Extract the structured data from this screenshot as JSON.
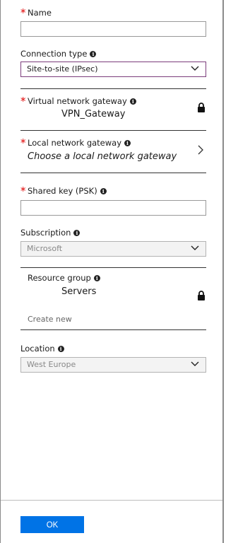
{
  "form": {
    "name": {
      "label": "Name",
      "value": ""
    },
    "connection_type": {
      "label": "Connection type",
      "value": "Site-to-site (IPsec)"
    },
    "virtual_network_gateway": {
      "label": "Virtual network gateway",
      "value": "VPN_Gateway"
    },
    "local_network_gateway": {
      "label": "Local network gateway",
      "placeholder": "Choose a local network gateway"
    },
    "shared_key": {
      "label": "Shared key (PSK)",
      "value": ""
    },
    "subscription": {
      "label": "Subscription",
      "value": "Microsoft"
    },
    "resource_group": {
      "label": "Resource group",
      "value": "Servers",
      "create_new": "Create new"
    },
    "location": {
      "label": "Location",
      "value": "West Europe"
    }
  },
  "footer": {
    "ok_label": "OK"
  },
  "icons": {
    "required": "*",
    "info": "i",
    "lock": "lock-icon",
    "chevron_down": "chevron-down-icon",
    "chevron_right": "chevron-right-icon"
  },
  "colors": {
    "required": "#e00000",
    "primary_button": "#0073e6",
    "active_border": "#7b3c7b"
  }
}
